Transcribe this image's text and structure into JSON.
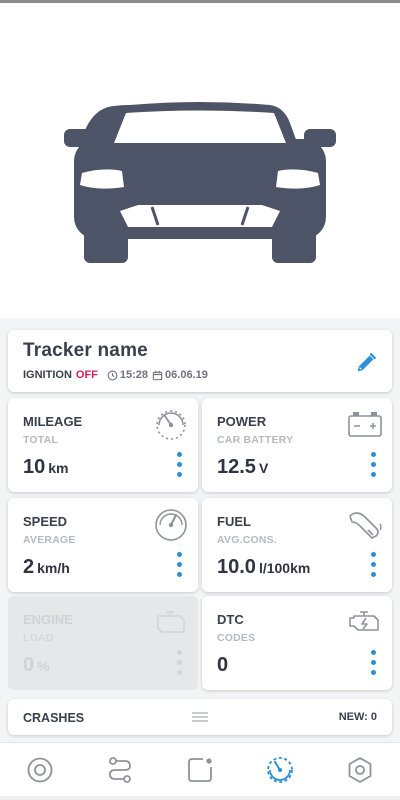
{
  "hero": {
    "icon": "car-front-icon"
  },
  "tracker": {
    "name": "Tracker name",
    "ignition_label": "IGNITION",
    "ignition_status": "OFF",
    "time": "15:28",
    "date": "06.06.19",
    "status_color": "#d81b60",
    "edit_icon": "pencil-icon"
  },
  "metrics": {
    "mileage": {
      "title": "MILEAGE",
      "subtitle": "TOTAL",
      "value": "10",
      "unit": "km",
      "icon": "odometer-icon"
    },
    "power": {
      "title": "POWER",
      "subtitle": "CAR BATTERY",
      "value": "12.5",
      "unit": "V",
      "icon": "battery-icon"
    },
    "speed": {
      "title": "SPEED",
      "subtitle": "AVERAGE",
      "value": "2",
      "unit": "km/h",
      "icon": "speedometer-icon"
    },
    "fuel": {
      "title": "FUEL",
      "subtitle": "AVG.CONS.",
      "value": "10.0",
      "unit": "l/100km",
      "icon": "fuel-nozzle-icon"
    },
    "engine": {
      "title": "ENGINE",
      "subtitle": "LOAD",
      "value": "0",
      "unit": "%",
      "icon": "engine-icon",
      "disabled": true
    },
    "dtc": {
      "title": "DTC",
      "subtitle": "CODES",
      "value": "0",
      "unit": "",
      "icon": "engine-warning-icon"
    }
  },
  "crashes": {
    "label": "CRASHES",
    "new_label": "NEW: 0"
  },
  "tabs": [
    {
      "name": "tracker",
      "icon": "target-icon",
      "active": false
    },
    {
      "name": "routes",
      "icon": "route-icon",
      "active": false
    },
    {
      "name": "notifications",
      "icon": "notification-icon",
      "active": false
    },
    {
      "name": "dashboard",
      "icon": "gauge-icon",
      "active": true
    },
    {
      "name": "settings",
      "icon": "hexagon-settings-icon",
      "active": false
    }
  ],
  "colors": {
    "accent": "#2d8fd6",
    "icon_gray": "#8e929c",
    "car": "#4e5468",
    "alert": "#d81b60"
  }
}
